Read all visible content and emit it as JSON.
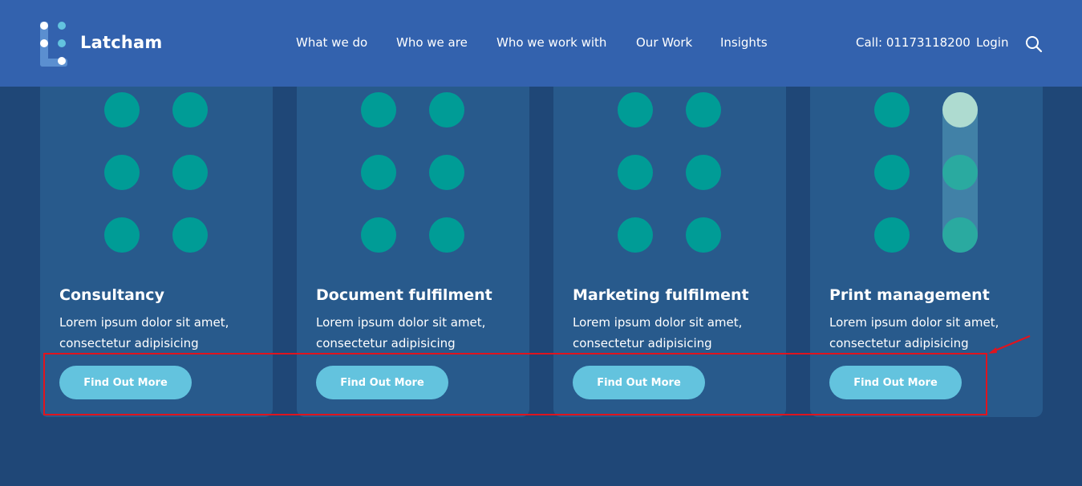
{
  "header": {
    "brand": "Latcham",
    "nav": [
      {
        "label": "What we do"
      },
      {
        "label": "Who we are"
      },
      {
        "label": "Who we work with"
      },
      {
        "label": "Our Work"
      },
      {
        "label": "Insights"
      }
    ],
    "call": "Call: 01173118200",
    "login": "Login",
    "search_icon": "search-icon"
  },
  "cards": [
    {
      "title": "Consultancy",
      "description": "Lorem ipsum dolor sit amet, consectetur adipisicing",
      "button": "Find Out More"
    },
    {
      "title": "Document fulfilment",
      "description": "Lorem ipsum dolor sit amet, consectetur adipisicing",
      "button": "Find Out More"
    },
    {
      "title": "Marketing fulfilment",
      "description": "Lorem ipsum dolor sit amet, consectetur adipisicing",
      "button": "Find Out More"
    },
    {
      "title": "Print management",
      "description": "Lorem ipsum dolor sit amet, consectetur adipisicing",
      "button": "Find Out More"
    }
  ],
  "colors": {
    "header_bg": "#3362ae",
    "page_bg": "#1f4777",
    "card_bg": "#285a8c",
    "dot": "#009c96",
    "button": "#63c3de",
    "annotation": "#e0141e"
  }
}
